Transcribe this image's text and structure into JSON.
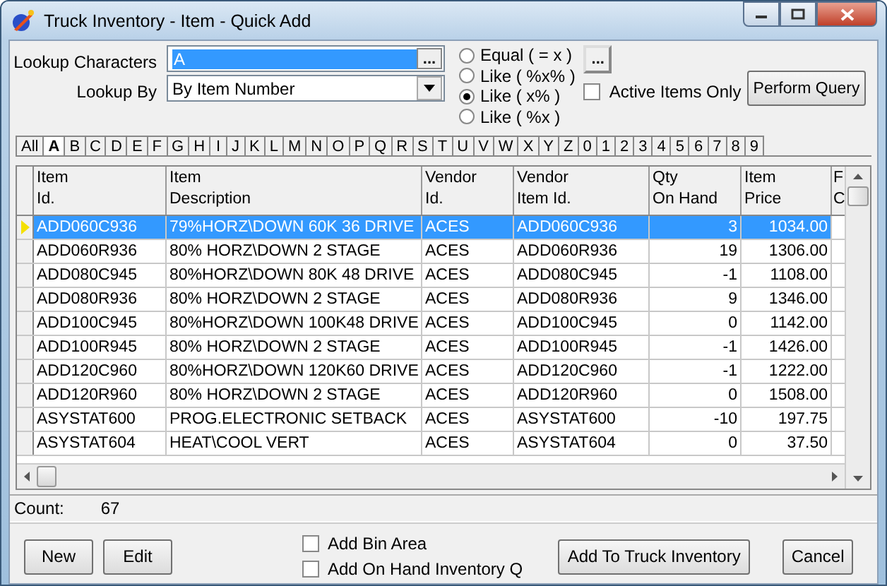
{
  "window": {
    "title": "Truck Inventory - Item - Quick Add"
  },
  "lookup": {
    "characters_label": "Lookup Characters",
    "characters_value": "A",
    "characters_button": "...",
    "by_label": "Lookup By",
    "by_value": "By Item Number"
  },
  "match_options": [
    {
      "label": "Equal ( = x )",
      "selected": false
    },
    {
      "label": "Like ( %x% )",
      "selected": false
    },
    {
      "label": "Like ( x% )",
      "selected": true
    },
    {
      "label": "Like ( %x )",
      "selected": false
    }
  ],
  "options_button": "...",
  "active_items_only": {
    "label": "Active Items Only",
    "checked": false
  },
  "perform_query_button": "Perform Query",
  "letter_tabs": [
    {
      "label": "All",
      "selected": false
    },
    {
      "label": "A",
      "selected": true
    },
    {
      "label": "B",
      "selected": false
    },
    {
      "label": "C",
      "selected": false
    },
    {
      "label": "D",
      "selected": false
    },
    {
      "label": "E",
      "selected": false
    },
    {
      "label": "F",
      "selected": false
    },
    {
      "label": "G",
      "selected": false
    },
    {
      "label": "H",
      "selected": false
    },
    {
      "label": "I",
      "selected": false
    },
    {
      "label": "J",
      "selected": false
    },
    {
      "label": "K",
      "selected": false
    },
    {
      "label": "L",
      "selected": false
    },
    {
      "label": "M",
      "selected": false
    },
    {
      "label": "N",
      "selected": false
    },
    {
      "label": "O",
      "selected": false
    },
    {
      "label": "P",
      "selected": false
    },
    {
      "label": "Q",
      "selected": false
    },
    {
      "label": "R",
      "selected": false
    },
    {
      "label": "S",
      "selected": false
    },
    {
      "label": "T",
      "selected": false
    },
    {
      "label": "U",
      "selected": false
    },
    {
      "label": "V",
      "selected": false
    },
    {
      "label": "W",
      "selected": false
    },
    {
      "label": "X",
      "selected": false
    },
    {
      "label": "Y",
      "selected": false
    },
    {
      "label": "Z",
      "selected": false
    },
    {
      "label": "0",
      "selected": false
    },
    {
      "label": "1",
      "selected": false
    },
    {
      "label": "2",
      "selected": false
    },
    {
      "label": "3",
      "selected": false
    },
    {
      "label": "4",
      "selected": false
    },
    {
      "label": "5",
      "selected": false
    },
    {
      "label": "6",
      "selected": false
    },
    {
      "label": "7",
      "selected": false
    },
    {
      "label": "8",
      "selected": false
    },
    {
      "label": "9",
      "selected": false
    }
  ],
  "table": {
    "columns": [
      {
        "lines": [
          "Item",
          "Id."
        ]
      },
      {
        "lines": [
          "Item",
          "Description"
        ]
      },
      {
        "lines": [
          "Vendor",
          "Id."
        ]
      },
      {
        "lines": [
          "Vendor",
          "Item Id."
        ]
      },
      {
        "lines": [
          "Qty",
          "On Hand"
        ]
      },
      {
        "lines": [
          "Item",
          "Price"
        ]
      },
      {
        "lines": [
          "F",
          "C"
        ]
      }
    ],
    "rows": [
      {
        "cells": [
          "ADD060C936",
          "79%HORZ\\DOWN 60K 36 DRIVE",
          "ACES",
          "ADD060C936",
          "3",
          "1034.00"
        ],
        "selected": true
      },
      {
        "cells": [
          "ADD060R936",
          "80% HORZ\\DOWN 2 STAGE",
          "ACES",
          "ADD060R936",
          "19",
          "1306.00"
        ],
        "selected": false
      },
      {
        "cells": [
          "ADD080C945",
          "80%HORZ\\DOWN 80K 48 DRIVE",
          "ACES",
          "ADD080C945",
          "-1",
          "1108.00"
        ],
        "selected": false
      },
      {
        "cells": [
          "ADD080R936",
          "80% HORZ\\DOWN 2 STAGE",
          "ACES",
          "ADD080R936",
          "9",
          "1346.00"
        ],
        "selected": false
      },
      {
        "cells": [
          "ADD100C945",
          "80%HORZ\\DOWN 100K48 DRIVE",
          "ACES",
          "ADD100C945",
          "0",
          "1142.00"
        ],
        "selected": false
      },
      {
        "cells": [
          "ADD100R945",
          "80% HORZ\\DOWN 2 STAGE",
          "ACES",
          "ADD100R945",
          "-1",
          "1426.00"
        ],
        "selected": false
      },
      {
        "cells": [
          "ADD120C960",
          "80%HORZ\\DOWN 120K60 DRIVE",
          "ACES",
          "ADD120C960",
          "-1",
          "1222.00"
        ],
        "selected": false
      },
      {
        "cells": [
          "ADD120R960",
          "80% HORZ\\DOWN 2 STAGE",
          "ACES",
          "ADD120R960",
          "0",
          "1508.00"
        ],
        "selected": false
      },
      {
        "cells": [
          "ASYSTAT600",
          "PROG.ELECTRONIC SETBACK",
          "ACES",
          "ASYSTAT600",
          "-10",
          "197.75"
        ],
        "selected": false
      },
      {
        "cells": [
          "ASYSTAT604",
          "HEAT\\COOL VERT",
          "ACES",
          "ASYSTAT604",
          "0",
          "37.50"
        ],
        "selected": false
      }
    ]
  },
  "count": {
    "label": "Count:",
    "value": "67"
  },
  "buttons_left": [
    "New",
    "Edit"
  ],
  "add_options": [
    {
      "label": "Add Bin Area",
      "checked": false
    },
    {
      "label": "Add On Hand Inventory Q",
      "checked": false
    }
  ],
  "add_button": "Add To Truck Inventory",
  "cancel_button": "Cancel"
}
